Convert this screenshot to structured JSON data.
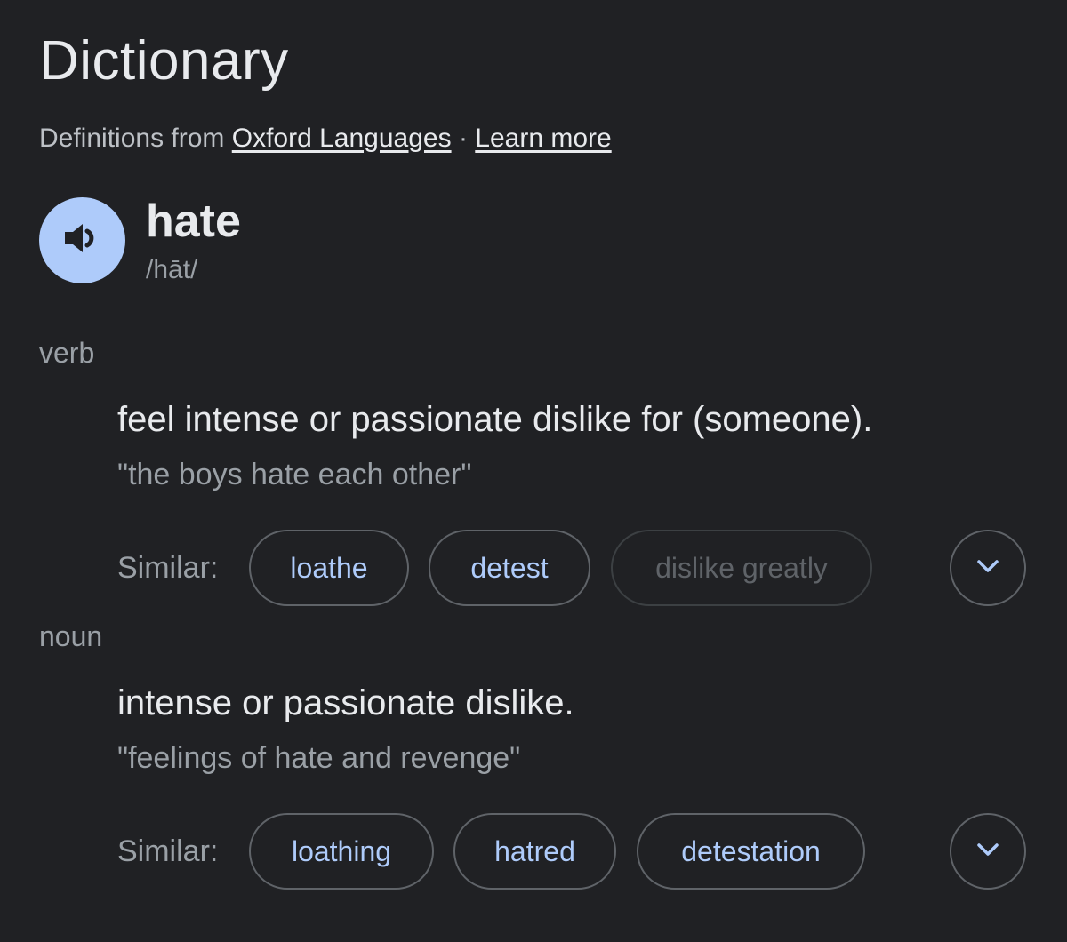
{
  "header": {
    "title": "Dictionary",
    "source_prefix": "Definitions from",
    "source_link": "Oxford Languages",
    "separator": "·",
    "learn_more": "Learn more"
  },
  "entry": {
    "word": "hate",
    "phonetic": "/hāt/"
  },
  "senses": [
    {
      "pos": "verb",
      "definition": "feel intense or passionate dislike for (someone).",
      "example": "\"the boys hate each other\"",
      "similar_label": "Similar:",
      "similar": [
        "loathe",
        "detest",
        "dislike greatly"
      ],
      "similar_disabled_index": 2
    },
    {
      "pos": "noun",
      "definition": "intense or passionate dislike.",
      "example": "\"feelings of hate and revenge\"",
      "similar_label": "Similar:",
      "similar": [
        "loathing",
        "hatred",
        "detestation"
      ]
    }
  ],
  "icons": {
    "speaker": "speaker-icon",
    "expand": "chevron-down-icon"
  },
  "colors": {
    "background": "#202124",
    "accent": "#aecbfa",
    "text": "#e8eaed",
    "muted": "#9aa0a6"
  }
}
